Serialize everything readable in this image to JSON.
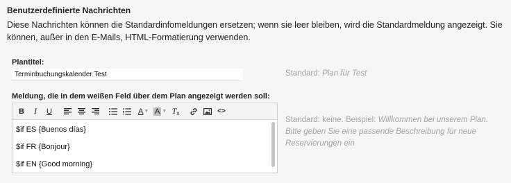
{
  "section": {
    "title": "Benutzerdefinierte Nachrichten",
    "description": "Diese Nachrichten können die Standardinfomeldungen ersetzen; wenn sie leer bleiben, wird die Standardmeldung angezeigt. Sie können, außer in den E-Mails, HTML-Formatierung verwenden."
  },
  "plan_title": {
    "label": "Plantitel:",
    "value": "Terminbuchungskalender Test",
    "hint_prefix": "Standard:",
    "hint_value": "Plan für Test"
  },
  "message": {
    "label": "Meldung, die in dem weißen Feld über dem Plan angezeigt werden soll:",
    "lines": [
      "$if ES {Buenos días}",
      "$if FR {Bonjour}",
      "$if EN {Good morning}"
    ],
    "hint_prefix": "Standard: keine. Beispiel:",
    "hint_example": "Willkommen bei unserem Plan. Bitte geben Sie eine passende Beschreibung für neue Reservierungen ein"
  },
  "toolbar": {
    "bold": "B",
    "italic": "I",
    "underline": "U",
    "text_color": "A",
    "bg_color": "A",
    "clear_format": "T",
    "clear_format_sub": "x",
    "source_code": "<>"
  }
}
